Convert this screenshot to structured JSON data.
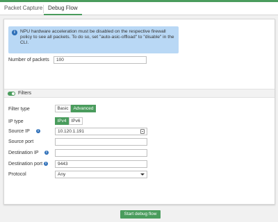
{
  "tabs": [
    {
      "label": "Packet Capture"
    },
    {
      "label": "Debug Flow"
    }
  ],
  "notice": {
    "text": "NPU hardware acceleration must be disabled on the respective firewall policy to see all packets. To do so, set \"auto-asic-offload\" to \"disable\" in the CLI."
  },
  "packets": {
    "label": "Number of packets",
    "value": "100"
  },
  "filters": {
    "label": "Filters",
    "enabled": true
  },
  "filter_type": {
    "label": "Filter type",
    "options": [
      "Basic",
      "Advanced"
    ],
    "selected": "Advanced"
  },
  "ip_type": {
    "label": "IP type",
    "options": [
      "IPv4",
      "IPv6"
    ],
    "selected": "IPv4"
  },
  "source_ip": {
    "label": "Source IP",
    "value": "10.120.1.191"
  },
  "source_port": {
    "label": "Source port",
    "value": ""
  },
  "destination_ip": {
    "label": "Destination IP",
    "value": ""
  },
  "destination_port": {
    "label": "Destination port",
    "value": "9443"
  },
  "protocol": {
    "label": "Protocol",
    "value": "Any"
  },
  "actions": {
    "start_label": "Start debug flow"
  },
  "colors": {
    "accent": "#4a9c5d",
    "info_blue": "#2d6fb8",
    "notice_bg": "#b9d8f5"
  }
}
